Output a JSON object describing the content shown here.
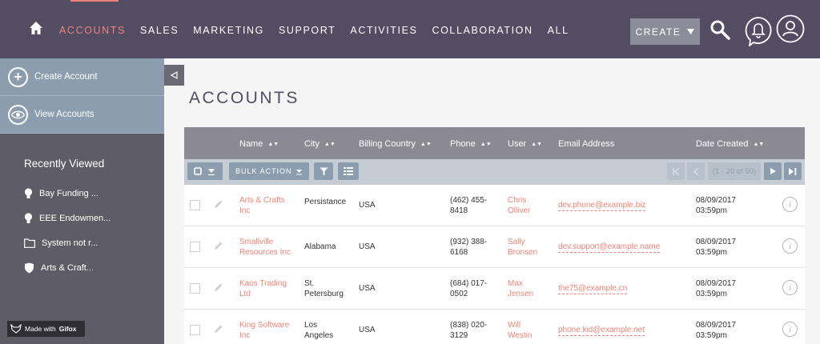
{
  "nav": {
    "items": [
      {
        "label": "ACCOUNTS",
        "active": true
      },
      {
        "label": "SALES"
      },
      {
        "label": "MARKETING"
      },
      {
        "label": "SUPPORT"
      },
      {
        "label": "ACTIVITIES"
      },
      {
        "label": "COLLABORATION"
      },
      {
        "label": "ALL"
      }
    ],
    "create_label": "CREATE"
  },
  "sidebar": {
    "actions": [
      {
        "label": "Create Account",
        "icon": "plus-icon"
      },
      {
        "label": "View Accounts",
        "icon": "eye-icon"
      }
    ],
    "recently_viewed_title": "Recently Viewed",
    "recently_viewed": [
      {
        "label": "Bay Funding ...",
        "icon": "lightbulb-icon"
      },
      {
        "label": "EEE Endowmen...",
        "icon": "lightbulb-icon"
      },
      {
        "label": "System not r...",
        "icon": "folder-icon"
      },
      {
        "label": "Arts & Craft...",
        "icon": "shield-icon"
      }
    ],
    "watermark": {
      "prefix": "Made with",
      "brand": "Gifox"
    }
  },
  "page": {
    "title": "ACCOUNTS"
  },
  "table": {
    "columns": [
      "Name",
      "City",
      "Billing Country",
      "Phone",
      "User",
      "Email Address",
      "Date Created"
    ],
    "bulk_action_label": "BULK ACTION",
    "pagination": "(1 - 20 of 50)",
    "rows": [
      {
        "name": [
          "Arts & Crafts",
          "Inc"
        ],
        "city": [
          "Persistance"
        ],
        "country": "USA",
        "phone": [
          "(462) 455-",
          "8418"
        ],
        "user": [
          "Chris",
          "Olliver"
        ],
        "email": "dev.phone@example.biz",
        "date": [
          "08/09/2017",
          "03:59pm"
        ]
      },
      {
        "name": [
          "Smallville",
          "Resources Inc"
        ],
        "city": [
          "Alabama"
        ],
        "country": "USA",
        "phone": [
          "(932) 388-",
          "6168"
        ],
        "user": [
          "Sally",
          "Bronsen"
        ],
        "email": "dev.support@example.name",
        "date": [
          "08/09/2017",
          "03:59pm"
        ]
      },
      {
        "name": [
          "Kaos Trading",
          "Ltd"
        ],
        "city": [
          "St.",
          "Petersburg"
        ],
        "country": "USA",
        "phone": [
          "(684) 017-",
          "0502"
        ],
        "user": [
          "Max",
          "Jensen"
        ],
        "email": "the75@example.cn",
        "date": [
          "08/09/2017",
          "03:59pm"
        ]
      },
      {
        "name": [
          "King Software",
          "Inc"
        ],
        "city": [
          "Los",
          "Angeles"
        ],
        "country": "USA",
        "phone": [
          "(838) 020-",
          "3129"
        ],
        "user": [
          "Will",
          "Westin"
        ],
        "email": "phone.kid@example.net",
        "date": [
          "08/09/2017",
          "03:59pm"
        ]
      }
    ]
  },
  "colors": {
    "nav_bg": "#534d64",
    "accent": "#f08377",
    "sidebar_action_bg": "#8b9dae",
    "sidebar_bg": "#5e5d67"
  }
}
